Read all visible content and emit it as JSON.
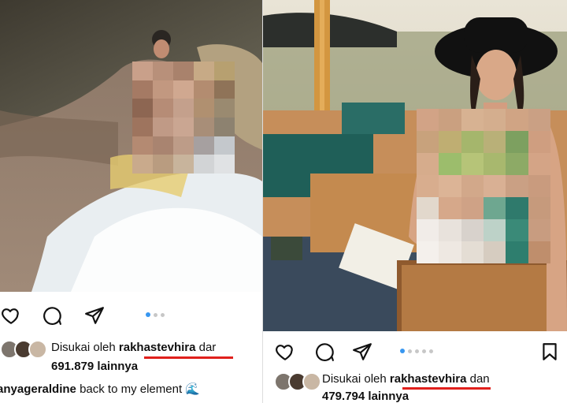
{
  "left_post": {
    "liked_by_prefix": "Disukai oleh",
    "liked_by_user": "rakhastevhira",
    "liked_by_suffix": "dar",
    "likes_count": "691.879",
    "likes_suffix": "lainnya",
    "caption_user": "anyageraldine",
    "caption_text": "back to my element 🌊",
    "carousel_dots": 3,
    "active_dot": 0
  },
  "right_post": {
    "liked_by_prefix": "Disukai oleh",
    "liked_by_user": "rakhastevhira",
    "liked_by_suffix": "dan",
    "likes_count": "479.794",
    "likes_suffix": "lainnya",
    "carousel_dots": 5,
    "active_dot": 0
  },
  "icons": {
    "like": "heart-icon",
    "comment": "comment-icon",
    "share": "send-icon",
    "save": "bookmark-icon"
  },
  "colors": {
    "highlight_underline": "#e0201c",
    "active_dot": "#3897f0"
  }
}
